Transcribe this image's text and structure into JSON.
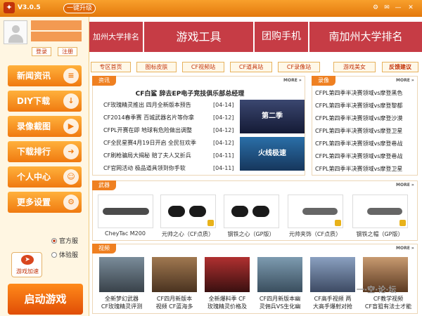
{
  "titlebar": {
    "version": "V3.0.5",
    "upgrade_label": "一键升级",
    "controls": [
      "⚙",
      "✉",
      "—",
      "✕"
    ]
  },
  "user": {
    "login_label": "登录",
    "register_label": "注册"
  },
  "left_nav": [
    {
      "label": "新闻资讯",
      "icon": "news-icon"
    },
    {
      "label": "DIY下载",
      "icon": "download-icon"
    },
    {
      "label": "录像截图",
      "icon": "play-icon"
    },
    {
      "label": "下载排行",
      "icon": "arrow-icon"
    },
    {
      "label": "个人中心",
      "icon": "person-icon"
    },
    {
      "label": "更多设置",
      "icon": "gear-icon"
    }
  ],
  "accelerator": {
    "label": "游戏加速"
  },
  "servers": [
    {
      "label": "官方服",
      "selected": true
    },
    {
      "label": "体验服",
      "selected": false
    }
  ],
  "start_button": "启动游戏",
  "banners": [
    "加州大学排名",
    "游戏工具",
    "团购手机",
    "南加州大学排名"
  ],
  "subtabs": [
    "专区首页",
    "图标皮肤",
    "CF视频站",
    "CF道具站",
    "CF录像站",
    "游戏美女",
    "反馈建议"
  ],
  "news": {
    "tag": "资讯",
    "more": "MORE »",
    "headline": "CF白鲨 辞去EP电子竞技俱乐部总经理",
    "items": [
      {
        "title": "CF玫瑰精灵推出 四月全新版本预告",
        "date": "[04-14]"
      },
      {
        "title": "CF2014春季赛 百城武器名片等你拿",
        "date": "[04-12]"
      },
      {
        "title": "CFPL开赛在即 地球有危险做出调整",
        "date": "[04-12]"
      },
      {
        "title": "CF全民星赛4月19日开启 全民狂欢季",
        "date": "[04-12]"
      },
      {
        "title": "CF刷枪骗局大揭秘 赔了夫人又折兵",
        "date": "[04-11]"
      },
      {
        "title": "CF官网活动 极品道具领到你手软",
        "date": "[04-11]"
      }
    ],
    "promos": [
      "第二季",
      "火线极速"
    ]
  },
  "recordings": {
    "tag": "录像",
    "more": "MORE »",
    "items": [
      "CFPL第四季半决赛领域vs摩登黑色",
      "CFPL第四季半决赛领域vs摩登黎都",
      "CFPL第四季半决赛领域vs摩登沙漠",
      "CFPL第四季半决赛领域vs摩登卫星",
      "CFPL第四季半决赛领域vs摩登巷战",
      "CFPL第四季半决赛领域vs摩登巷战",
      "CFPL第四季半决赛领域vs摩登卫星"
    ]
  },
  "weapons": {
    "tag": "武器",
    "more": "MORE »",
    "items": [
      "CheyTac M200",
      "元帅之心（CF点质）",
      "钢铁之心（GP版）",
      "元帅夹饰（CF点质）",
      "钢铁之帽（GP版）"
    ]
  },
  "videos": {
    "tag": "视频",
    "more": "MORE »",
    "items": [
      {
        "line1": "全新梦幻武器",
        "line2": "CF玫瑰精灵评测"
      },
      {
        "line1": "CF四月新版本",
        "line2": "视频 CF蓝海多"
      },
      {
        "line1": "全新爆料季 CF",
        "line2": "玫瑰精灵价格及"
      },
      {
        "line1": "CF四月新版本幽",
        "line2": "灵佣兵VS生化幽"
      },
      {
        "line1": "CF高手视频 两",
        "line2": "大高手爆射对抢"
      },
      {
        "line1": "CF教学视频",
        "line2": "CF盲狙有法士才能"
      }
    ]
  },
  "watermark": "一·空·论·坛"
}
